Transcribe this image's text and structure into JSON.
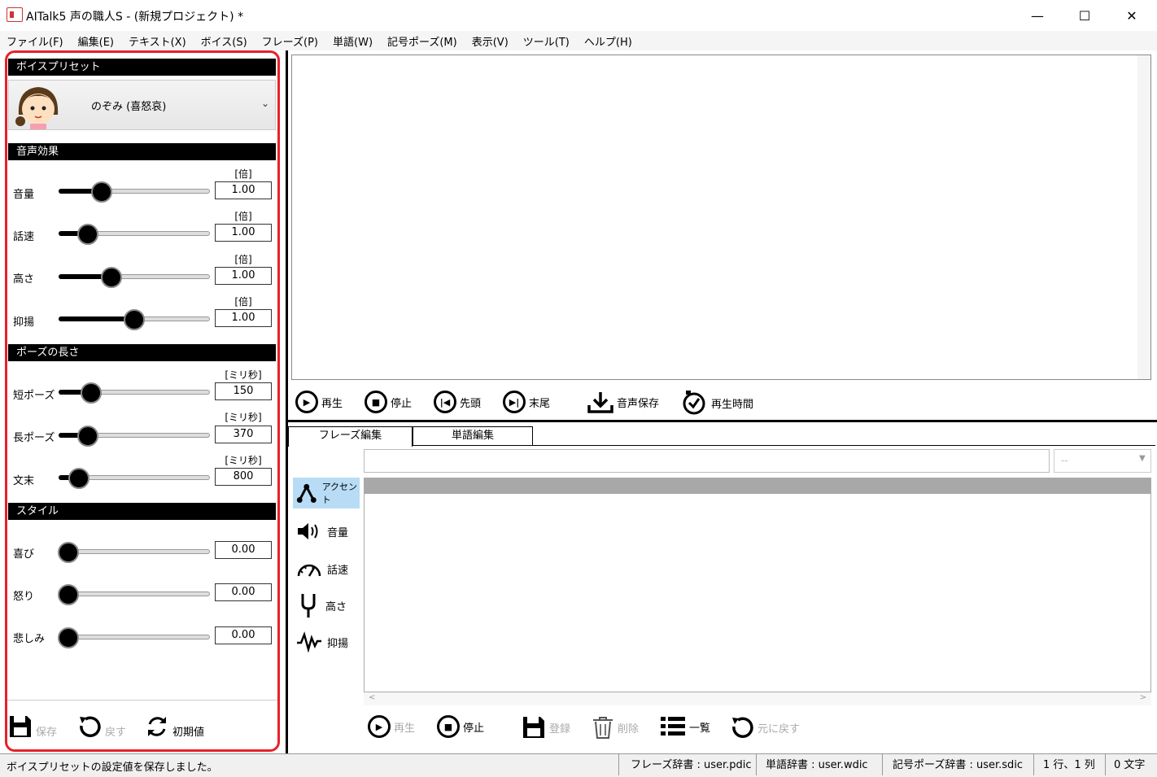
{
  "window": {
    "title": "AITalk5 声の職人S - (新規プロジェクト) *",
    "minimize": "—",
    "maximize": "☐",
    "close": "✕"
  },
  "menu": [
    "ファイル(F)",
    "編集(E)",
    "テキスト(X)",
    "ボイス(S)",
    "フレーズ(P)",
    "単語(W)",
    "記号ポーズ(M)",
    "表示(V)",
    "ツール(T)",
    "ヘルプ(H)"
  ],
  "left": {
    "preset_header": "ボイスプリセット",
    "voice_name": "のぞみ (喜怒哀)",
    "effects_header": "音声効果",
    "effects": [
      {
        "label": "音量",
        "unit": "[倍]",
        "value": "1.00",
        "level": 0.28
      },
      {
        "label": "話速",
        "unit": "[倍]",
        "value": "1.00",
        "level": 0.19
      },
      {
        "label": "高さ",
        "unit": "[倍]",
        "value": "1.00",
        "level": 0.35
      },
      {
        "label": "抑揚",
        "unit": "[倍]",
        "value": "1.00",
        "level": 0.5
      }
    ],
    "pause_header": "ポーズの長さ",
    "pauses": [
      {
        "label": "短ポーズ",
        "unit": "[ミリ秒]",
        "value": "150",
        "level": 0.21
      },
      {
        "label": "長ポーズ",
        "unit": "[ミリ秒]",
        "value": "370",
        "level": 0.19
      },
      {
        "label": "文末",
        "unit": "[ミリ秒]",
        "value": "800",
        "level": 0.13
      }
    ],
    "style_header": "スタイル",
    "styles": [
      {
        "label": "喜び",
        "value": "0.00",
        "level": 0.06
      },
      {
        "label": "怒り",
        "value": "0.00",
        "level": 0.06
      },
      {
        "label": "悲しみ",
        "value": "0.00",
        "level": 0.06
      }
    ],
    "save_label": "保存",
    "undo_label": "戻す",
    "reset_label": "初期値"
  },
  "player": {
    "play": "再生",
    "stop": "停止",
    "head": "先頭",
    "tail": "末尾",
    "save_audio": "音声保存",
    "play_time": "再生時間"
  },
  "tabs": {
    "phrase": "フレーズ編集",
    "word": "単語編集"
  },
  "phrase_select": "--",
  "side_tools": [
    {
      "label": "アクセント",
      "icon": "accent-icon",
      "active": true
    },
    {
      "label": "音量",
      "icon": "speaker-icon",
      "active": false
    },
    {
      "label": "話速",
      "icon": "speedometer-icon",
      "active": false
    },
    {
      "label": "高さ",
      "icon": "tuning-fork-icon",
      "active": false
    },
    {
      "label": "抑揚",
      "icon": "waveform-icon",
      "active": false
    }
  ],
  "bottom_toolbar": {
    "play": "再生",
    "stop": "停止",
    "register": "登録",
    "delete": "削除",
    "list": "一覧",
    "revert": "元に戻す"
  },
  "status": {
    "message": "ボイスプリセットの設定値を保存しました。",
    "phrase_dic": "フレーズ辞書 : user.pdic",
    "word_dic": "単語辞書 : user.wdic",
    "symbol_dic": "記号ポーズ辞書 : user.sdic",
    "position": "1 行、1 列",
    "chars": "0 文字"
  }
}
